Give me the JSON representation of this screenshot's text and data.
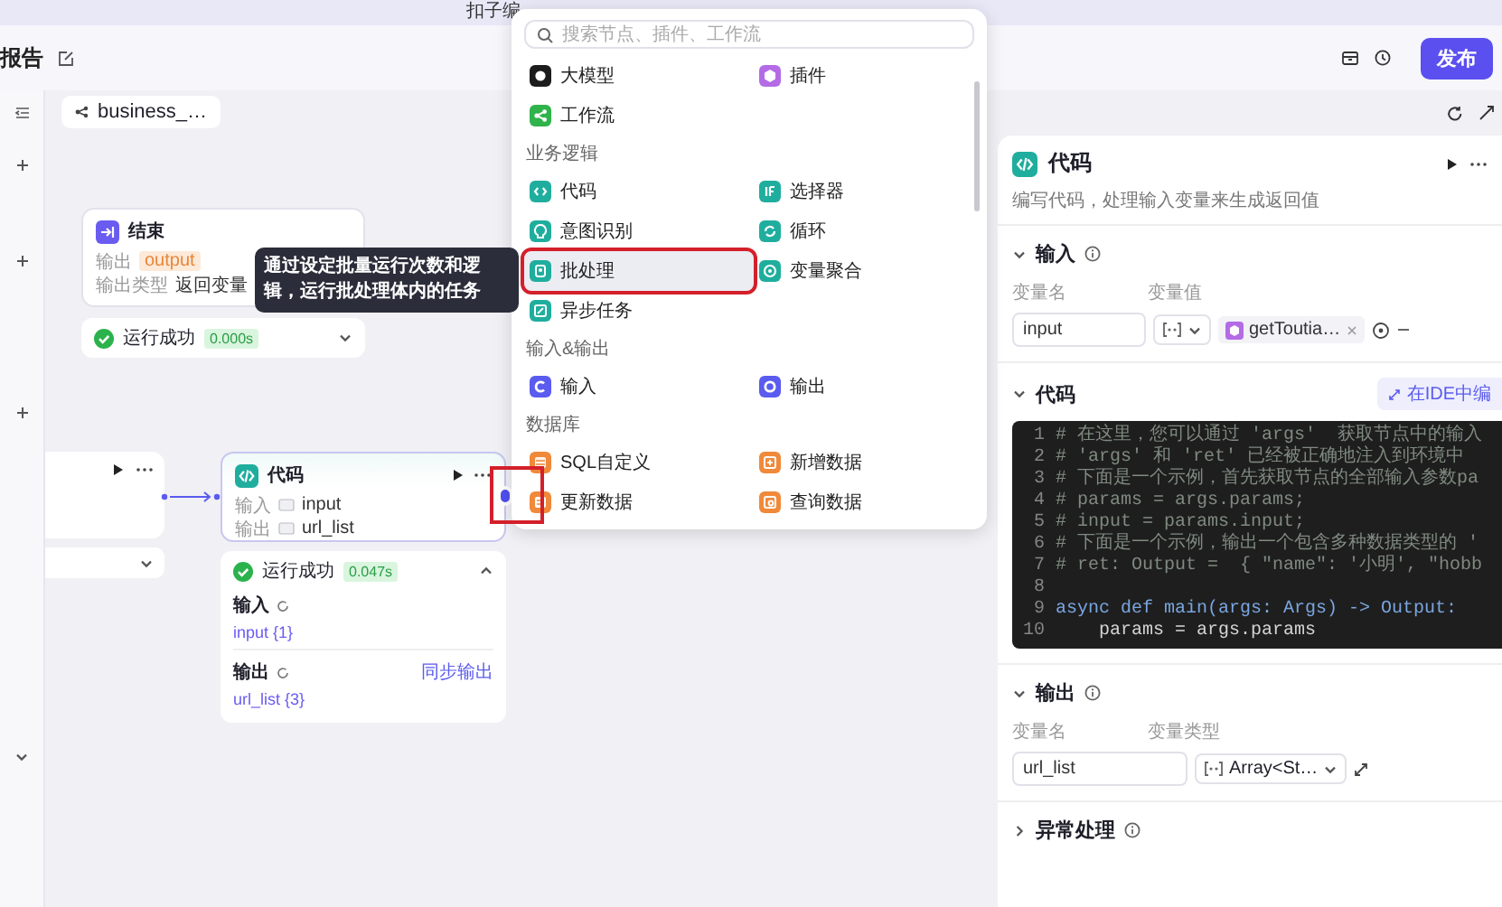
{
  "banner": {
    "text": "扣子编"
  },
  "header": {
    "title": "报告",
    "publish": "发布"
  },
  "canvas": {
    "tab": "business_…",
    "end_node": {
      "title": "结束",
      "rows": [
        {
          "label": "输出",
          "value": "output",
          "kind": "tag"
        },
        {
          "label": "输出类型",
          "value": "返回变量",
          "kind": "text"
        }
      ],
      "status": {
        "label": "运行成功",
        "time": "0.000s",
        "expanded": false
      }
    },
    "code_node": {
      "title": "代码",
      "annotated": true,
      "rows": [
        {
          "label": "输入",
          "value": "input"
        },
        {
          "label": "输出",
          "value": "url_list"
        }
      ],
      "status": {
        "label": "运行成功",
        "time": "0.047s",
        "expanded": true
      },
      "result": [
        {
          "title": "输入",
          "items": [
            {
              "name": "input",
              "count": "{1}"
            }
          ]
        },
        {
          "title": "输出",
          "action": "同步输出",
          "items": [
            {
              "name": "url_list",
              "count": "{3}"
            }
          ]
        }
      ]
    },
    "tooltip": "通过设定批量运行次数和逻辑，运行批处理体内的任务"
  },
  "menu": {
    "placeholder": "搜索节点、插件、工作流",
    "groups": [
      {
        "items": [
          {
            "label": "大模型",
            "kind": "llm",
            "color": "#1c1c1c",
            "selected": false,
            "annotated": false
          },
          {
            "label": "插件",
            "kind": "plugin",
            "color": "#b46be6",
            "selected": false,
            "annotated": false
          },
          {
            "label": "工作流",
            "kind": "workflow",
            "color": "#2fb34a",
            "selected": false,
            "annotated": false
          }
        ]
      },
      {
        "title": "业务逻辑",
        "items": [
          {
            "label": "代码",
            "kind": "code",
            "color": "#1fae9e",
            "selected": false,
            "annotated": false
          },
          {
            "label": "选择器",
            "kind": "selector",
            "color": "#1fae9e",
            "selected": false,
            "annotated": false
          },
          {
            "label": "意图识别",
            "kind": "intent",
            "color": "#1fae9e",
            "selected": false,
            "annotated": false
          },
          {
            "label": "循环",
            "kind": "loop",
            "color": "#1fae9e",
            "selected": false,
            "annotated": false
          },
          {
            "label": "批处理",
            "kind": "batch",
            "color": "#1fae9e",
            "selected": true,
            "annotated": true
          },
          {
            "label": "变量聚合",
            "kind": "aggregate",
            "color": "#1fae9e",
            "selected": false,
            "annotated": false
          },
          {
            "label": "异步任务",
            "kind": "async",
            "color": "#1fae9e",
            "selected": false,
            "annotated": false
          }
        ]
      },
      {
        "title": "输入&输出",
        "items": [
          {
            "label": "输入",
            "kind": "input",
            "color": "#5a5bef",
            "selected": false,
            "annotated": false
          },
          {
            "label": "输出",
            "kind": "output",
            "color": "#5a5bef",
            "selected": false,
            "annotated": false
          }
        ]
      },
      {
        "title": "数据库",
        "items": [
          {
            "label": "SQL自定义",
            "kind": "sql",
            "color": "#f0893a",
            "selected": false,
            "annotated": false
          },
          {
            "label": "新增数据",
            "kind": "insert",
            "color": "#f0893a",
            "selected": false,
            "annotated": false
          },
          {
            "label": "更新数据",
            "kind": "update",
            "color": "#f0893a",
            "selected": false,
            "annotated": false
          },
          {
            "label": "查询数据",
            "kind": "query",
            "color": "#f0893a",
            "selected": false,
            "annotated": false
          }
        ]
      }
    ]
  },
  "panel": {
    "title": "代码",
    "description": "编写代码，处理输入变量来生成返回值",
    "sections": [
      {
        "kind": "input",
        "title": "输入",
        "expanded": true,
        "columns": [
          "变量名",
          "变量值"
        ],
        "rows": [
          {
            "name": "input",
            "reference": "getToutia…"
          }
        ]
      },
      {
        "kind": "code",
        "title": "代码",
        "expanded": true,
        "action": "在IDE中编",
        "lines": [
          {
            "number": "1",
            "kind": "comment",
            "text": "# 在这里，您可以通过 'args'  获取节点中的输入"
          },
          {
            "number": "2",
            "kind": "comment",
            "text": "# 'args' 和 'ret' 已经被正确地注入到环境中"
          },
          {
            "number": "3",
            "kind": "comment",
            "text": "# 下面是一个示例，首先获取节点的全部输入参数pa"
          },
          {
            "number": "4",
            "kind": "comment",
            "text": "# params = args.params;"
          },
          {
            "number": "5",
            "kind": "comment",
            "text": "# input = params.input;"
          },
          {
            "number": "6",
            "kind": "comment",
            "text": "# 下面是一个示例，输出一个包含多种数据类型的 '"
          },
          {
            "number": "7",
            "kind": "comment",
            "text": "# ret: Output =  { \"name\": '小明', \"hobb"
          },
          {
            "number": "8",
            "kind": "blank"
          },
          {
            "number": "9",
            "kind": "code",
            "text": "async def main(args: Args) -> Output:"
          },
          {
            "number": "10",
            "kind": "body",
            "text": "params = args.params"
          }
        ]
      },
      {
        "kind": "output",
        "title": "输出",
        "expanded": true,
        "columns": [
          "变量名",
          "变量类型"
        ],
        "rows": [
          {
            "name": "url_list",
            "type": "Array<St…"
          }
        ]
      },
      {
        "kind": "error",
        "title": "异常处理",
        "expanded": false
      }
    ]
  }
}
